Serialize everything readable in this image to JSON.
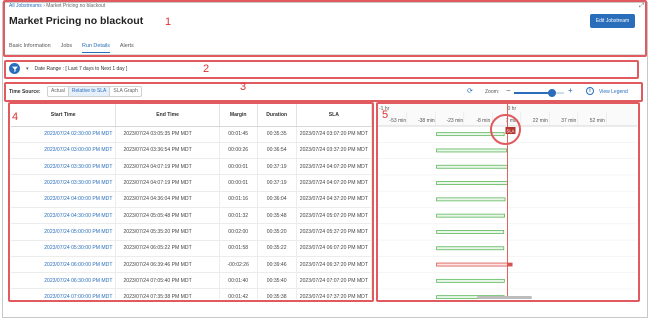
{
  "breadcrumb": {
    "root": "All Jobstreams",
    "separator": "›",
    "current": "Market Pricing no blackout"
  },
  "page": {
    "title": "Market Pricing no blackout",
    "edit_label": "Edit Jobstream"
  },
  "tabs": [
    {
      "label": "Basic Information",
      "active": false
    },
    {
      "label": "Jobs",
      "active": false
    },
    {
      "label": "Run Details",
      "active": true
    },
    {
      "label": "Alerts",
      "active": false
    }
  ],
  "filter": {
    "label": "Date Range : [ Last 7 days to Next 1 day ]"
  },
  "toolbar": {
    "time_source_label": "Time Source:",
    "options": [
      {
        "label": "Actual",
        "selected": false
      },
      {
        "label": "Relative to SLA",
        "selected": true
      },
      {
        "label": "SLA Graph",
        "selected": false
      }
    ],
    "zoom_label": "Zoom:",
    "zoom_level": 0.75,
    "legend_label": "View Legend"
  },
  "table": {
    "columns": [
      "Start Time",
      "End Time",
      "Margin",
      "Duration",
      "SLA"
    ],
    "rows": [
      [
        "2023/07/24 02:30:00 PM MDT",
        "2023/07/24 03:05:35 PM MDT",
        "00:01:45",
        "00:35:35",
        "2023/07/24 03:07:20 PM MDT"
      ],
      [
        "2023/07/24 03:00:00 PM MDT",
        "2023/07/24 03:36:54 PM MDT",
        "00:00:26",
        "00:36:54",
        "2023/07/24 03:37:20 PM MDT"
      ],
      [
        "2023/07/24 03:30:00 PM MDT",
        "2023/07/24 04:07:19 PM MDT",
        "00:00:01",
        "00:37:19",
        "2023/07/24 04:07:20 PM MDT"
      ],
      [
        "2023/07/24 03:30:00 PM MDT",
        "2023/07/24 04:07:19 PM MDT",
        "00:00:01",
        "00:37:19",
        "2023/07/24 04:07:20 PM MDT"
      ],
      [
        "2023/07/24 04:00:00 PM MDT",
        "2023/07/24 04:36:04 PM MDT",
        "00:01:16",
        "00:36:04",
        "2023/07/24 04:37:20 PM MDT"
      ],
      [
        "2023/07/24 04:30:00 PM MDT",
        "2023/07/24 05:05:48 PM MDT",
        "00:01:32",
        "00:35:48",
        "2023/07/24 05:07:20 PM MDT"
      ],
      [
        "2023/07/24 05:00:00 PM MDT",
        "2023/07/24 05:35:20 PM MDT",
        "00:02:00",
        "00:35:20",
        "2023/07/24 05:37:20 PM MDT"
      ],
      [
        "2023/07/24 05:30:00 PM MDT",
        "2023/07/24 06:05:22 PM MDT",
        "00:01:58",
        "00:35:22",
        "2023/07/24 06:07:20 PM MDT"
      ],
      [
        "2023/07/24 06:00:00 PM MDT",
        "2023/07/24 06:39:46 PM MDT",
        "-00:02:26",
        "00:39:46",
        "2023/07/24 06:37:20 PM MDT"
      ],
      [
        "2023/07/24 06:30:00 PM MDT",
        "2023/07/24 07:05:40 PM MDT",
        "00:01:40",
        "00:35:40",
        "2023/07/24 07:07:20 PM MDT"
      ],
      [
        "2023/07/24 07:00:00 PM MDT",
        "2023/07/24 07:35:38 PM MDT",
        "00:01:42",
        "00:35:38",
        "2023/07/24 07:37:20 PM MDT"
      ],
      [
        "2023/07/24 07:30:00 PM MDT",
        "2023/07/24 08:05:42 PM MDT",
        "00:01:38",
        "00:35:42",
        "2023/07/24 08:07:20 PM MDT"
      ]
    ]
  },
  "gantt": {
    "hour_labels": [
      {
        "label": "-1 hr",
        "at": -68
      },
      {
        "label": "0 hr",
        "at": 0
      }
    ],
    "ticks": [
      {
        "label": "-53 min",
        "at": -53
      },
      {
        "label": "-38 min",
        "at": -38
      },
      {
        "label": "-23 min",
        "at": -23
      },
      {
        "label": "-8 min",
        "at": -8
      },
      {
        "label": "7 min",
        "at": 7
      },
      {
        "label": "22 min",
        "at": 22
      },
      {
        "label": "37 min",
        "at": 37
      },
      {
        "label": "52 min",
        "at": 52
      }
    ],
    "sla_label": "SLA",
    "colors": {
      "ok": "#5cb85c",
      "late": "#d9534f",
      "ok_fill": "#e9f6e9",
      "late_fill": "#fbe3e3",
      "sla_line": "#d9534f"
    }
  },
  "annotations": [
    "1",
    "2",
    "3",
    "4",
    "5"
  ]
}
